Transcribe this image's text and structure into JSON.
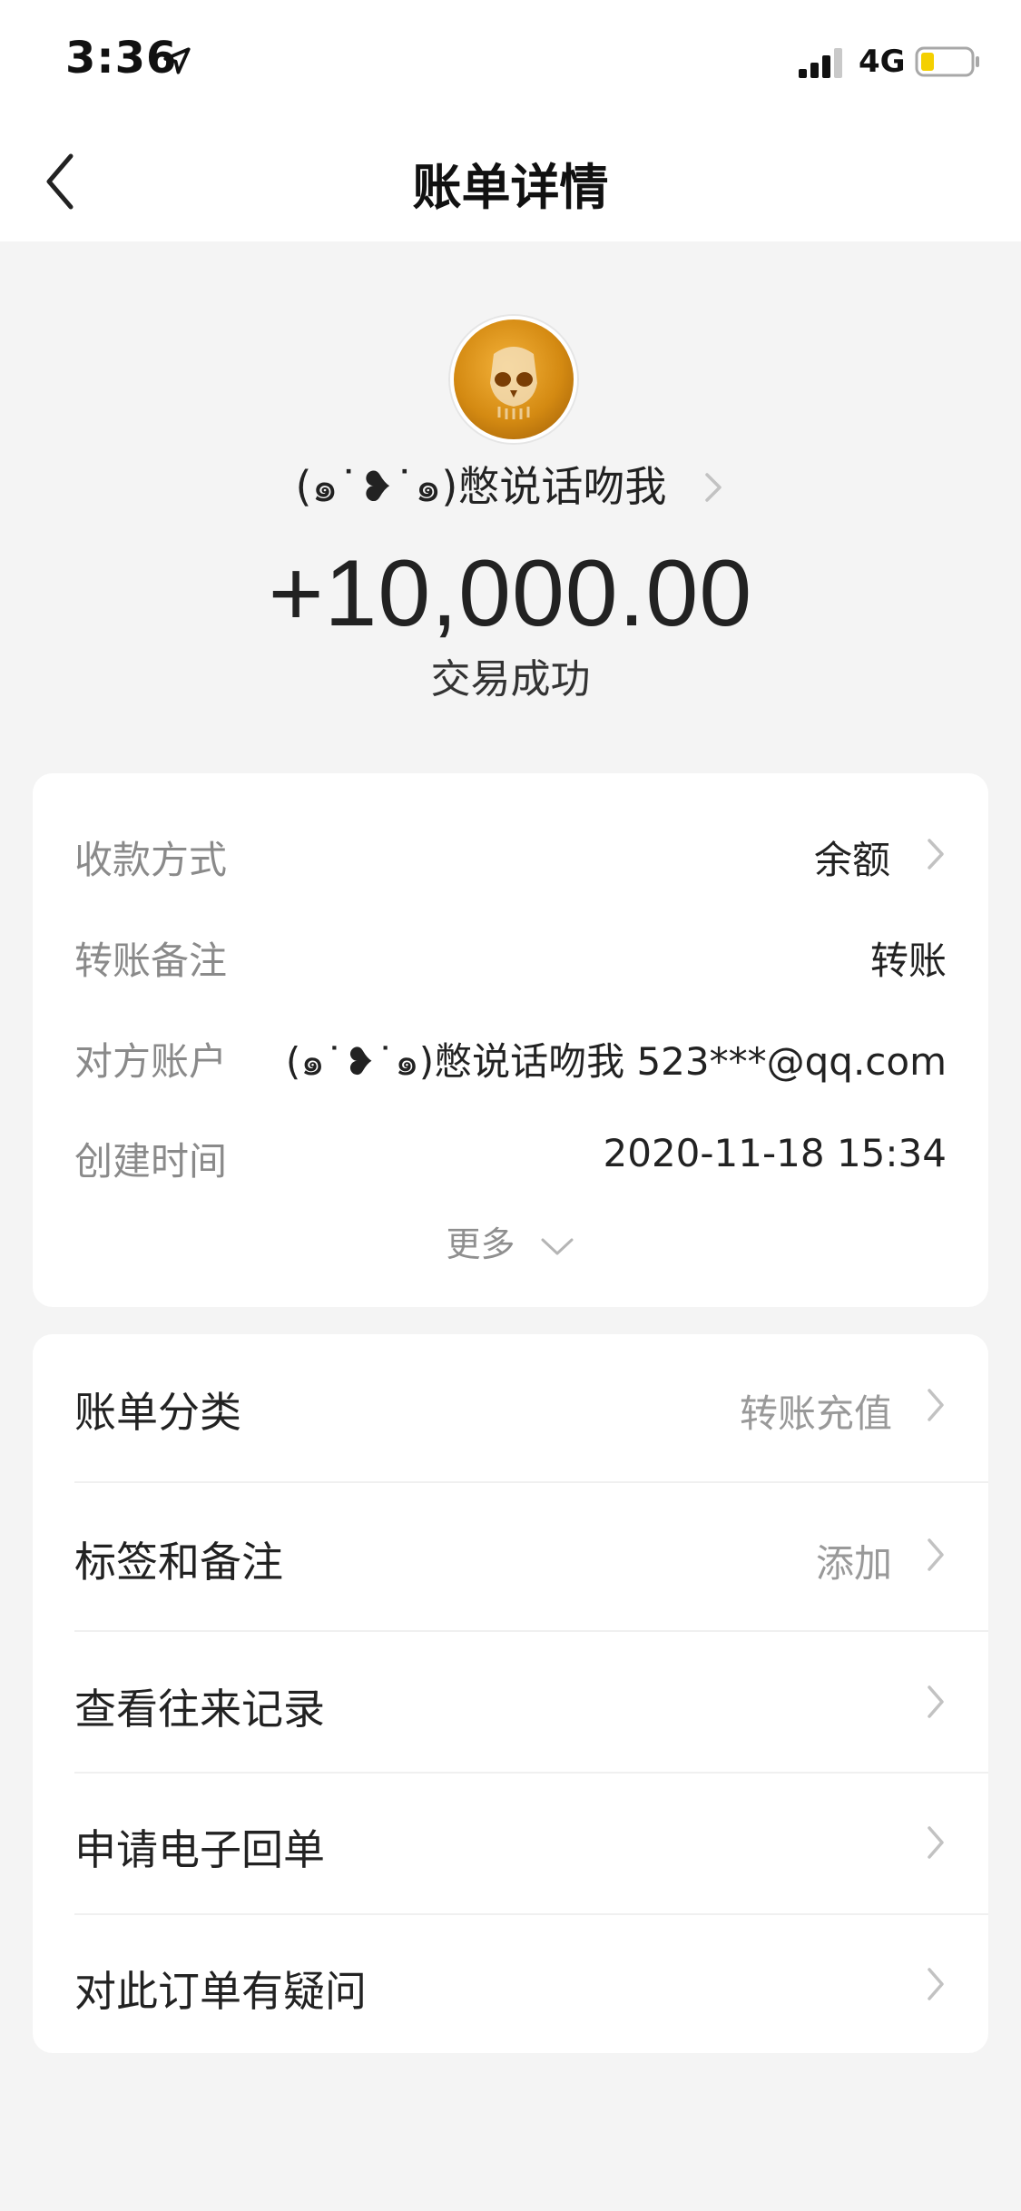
{
  "status_bar": {
    "time": "3:36",
    "network": "4G",
    "battery_color": "#f4d000"
  },
  "header": {
    "title": "账单详情"
  },
  "transaction": {
    "payer_name": "(๑˙❥˙๑)憋说话吻我",
    "amount": "+10,000.00",
    "status": "交易成功"
  },
  "details": {
    "rows": [
      {
        "label": "收款方式",
        "value": "余额"
      },
      {
        "label": "转账备注",
        "value": "转账"
      },
      {
        "label": "对方账户",
        "value": "(๑˙❥˙๑)憋说话吻我 523***@qq.com"
      },
      {
        "label": "创建时间",
        "value": "2020-11-18 15:34"
      }
    ],
    "more_label": "更多"
  },
  "menu": {
    "items": [
      {
        "label": "账单分类",
        "value": "转账充值"
      },
      {
        "label": "标签和备注",
        "value": "添加"
      },
      {
        "label": "查看往来记录",
        "value": ""
      },
      {
        "label": "申请电子回单",
        "value": ""
      },
      {
        "label": "对此订单有疑问",
        "value": ""
      }
    ]
  }
}
